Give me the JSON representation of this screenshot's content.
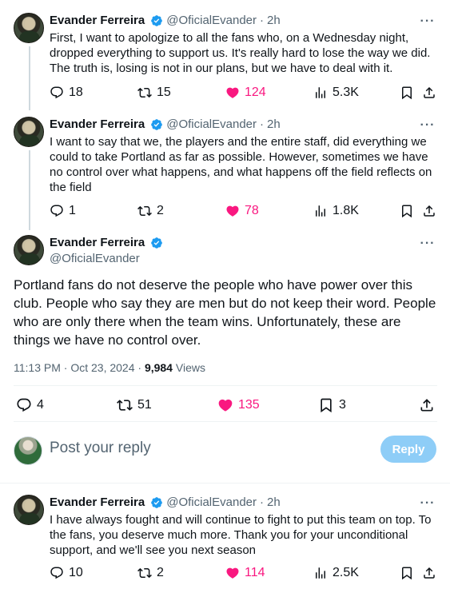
{
  "author": {
    "name": "Evander Ferreira",
    "handle": "@OficialEvander",
    "verified_color": "#1d9bf0"
  },
  "tweets": [
    {
      "time": "2h",
      "text": "First, I want to apologize to all the fans who, on a Wednesday night, dropped everything to support us. It's really hard to lose the way we did. The truth is, losing is not in our plans, but we have to deal with it.",
      "replies": "18",
      "reposts": "15",
      "likes": "124",
      "views": "5.3K"
    },
    {
      "time": "2h",
      "text": "I want to say that we, the players and the entire staff, did everything we could to take Portland as far as possible. However, sometimes we have no control over what happens, and what happens off the field reflects on the field",
      "replies": "1",
      "reposts": "2",
      "likes": "78",
      "views": "1.8K"
    }
  ],
  "main_tweet": {
    "text": "Portland fans do not deserve the people who have power over this club. People who say they are men but do not keep their word. People who are only there when the team wins. Unfortunately, these are things we have no control over.",
    "timestamp": "11:13 PM · Oct 23, 2024 · ",
    "views_count": "9,984",
    "views_label": " Views",
    "replies": "4",
    "reposts": "51",
    "likes": "135",
    "bookmarks": "3"
  },
  "reply_box": {
    "placeholder": "Post your reply",
    "button": "Reply"
  },
  "reply_tweet": {
    "time": "2h",
    "text": "I have always fought and will continue to fight to put this team on top. To the fans, you deserve much more. Thank you for your unconditional support, and we'll see you next season",
    "replies": "10",
    "reposts": "2",
    "likes": "114",
    "views": "2.5K"
  },
  "separator": "·",
  "colors": {
    "like": "#f91880",
    "muted": "#536471",
    "reply_button": "#8ecdf7",
    "verified": "#1d9bf0"
  }
}
